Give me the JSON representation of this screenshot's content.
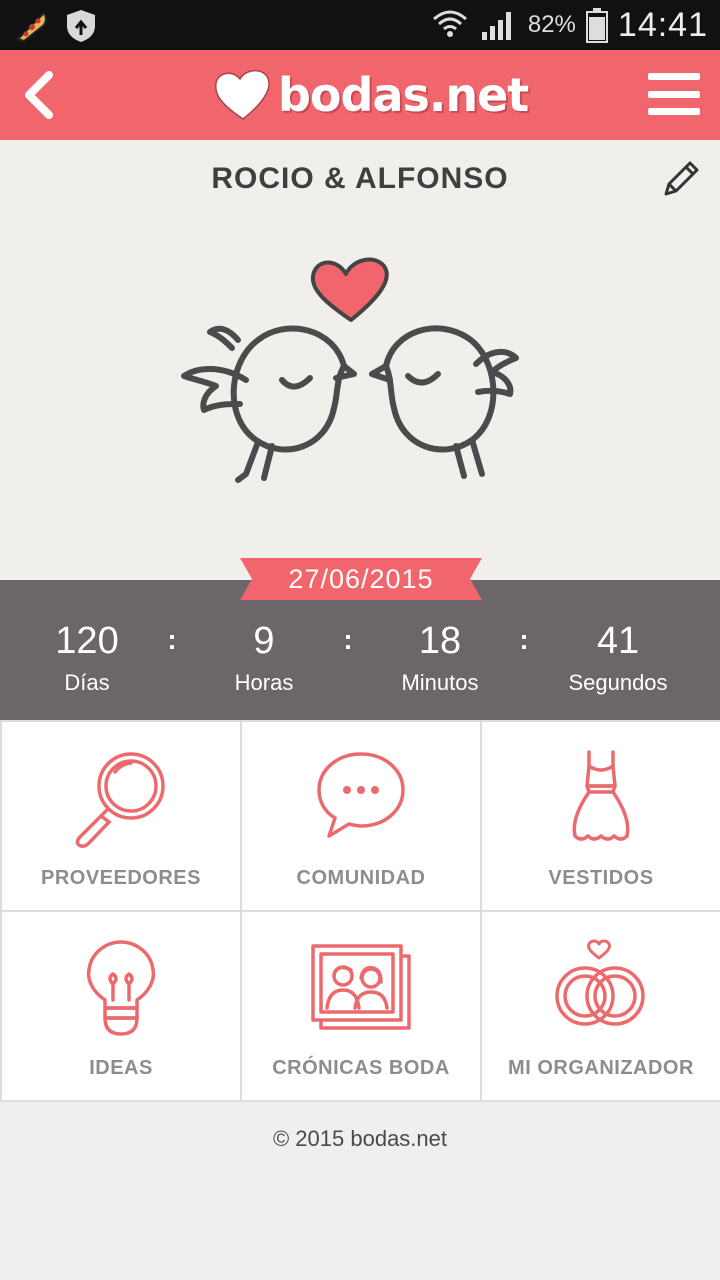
{
  "status_bar": {
    "battery_percent": "82%",
    "time": "14:41",
    "icons": [
      "pizza-icon",
      "shield-icon",
      "wifi-icon",
      "signal-icon",
      "battery-icon"
    ]
  },
  "header": {
    "logo_text": "bodas.net",
    "back_icon": "back-arrow-icon",
    "menu_icon": "hamburger-menu-icon",
    "brand_color": "#f0666c"
  },
  "hero": {
    "couple_name": "ROCIO & ALFONSO",
    "edit_icon": "pencil-icon",
    "illustration": "kissing-birds-heart"
  },
  "wedding_date": "27/06/2015",
  "countdown": {
    "separator": ":",
    "units": [
      {
        "value": "120",
        "label": "Días"
      },
      {
        "value": "9",
        "label": "Horas"
      },
      {
        "value": "18",
        "label": "Minutos"
      },
      {
        "value": "41",
        "label": "Segundos"
      }
    ]
  },
  "tiles": [
    {
      "label": "PROVEEDORES",
      "icon": "magnifier-icon"
    },
    {
      "label": "COMUNIDAD",
      "icon": "chat-bubble-icon"
    },
    {
      "label": "VESTIDOS",
      "icon": "dress-icon"
    },
    {
      "label": "IDEAS",
      "icon": "lightbulb-icon"
    },
    {
      "label": "CRÓNICAS BODA",
      "icon": "photo-album-icon"
    },
    {
      "label": "MI ORGANIZADOR",
      "icon": "rings-icon"
    }
  ],
  "footer": {
    "copyright": "© 2015 bodas.net"
  },
  "colors": {
    "accent": "#f0666c",
    "countdown_bg": "#6c6569",
    "tile_label": "#8d8d8d"
  }
}
